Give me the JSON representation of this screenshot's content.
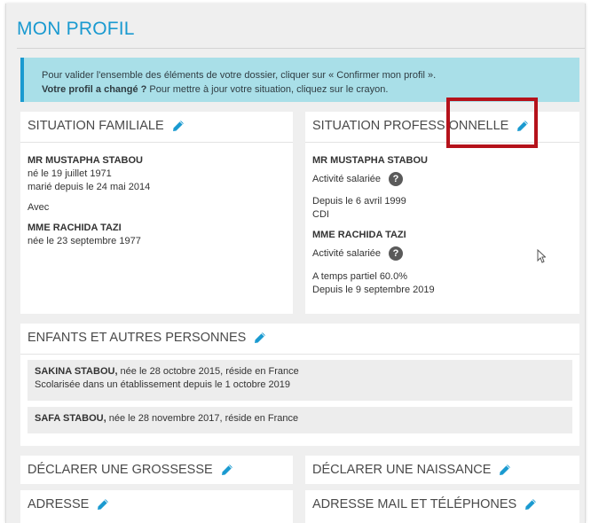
{
  "page": {
    "title": "MON PROFIL"
  },
  "info": {
    "line1": "Pour valider l'ensemble des éléments de votre dossier, cliquer sur « Confirmer mon profil ».",
    "line2_bold": "Votre profil a changé ?",
    "line2_rest": " Pour mettre à jour votre situation, cliquez sur le crayon."
  },
  "situation_familiale": {
    "title": "SITUATION FAMILIALE",
    "person1_name": "MR MUSTAPHA STABOU",
    "person1_birth": "né le 19 juillet 1971",
    "person1_marriage": "marié depuis le 24 mai 2014",
    "with_label": "Avec",
    "person2_name": "MME RACHIDA TAZI",
    "person2_birth": "née le 23 septembre 1977"
  },
  "situation_professionnelle": {
    "title": "SITUATION PROFESSIONNELLE",
    "person1_name": "MR MUSTAPHA STABOU",
    "person1_activity": "Activité salariée",
    "person1_since": "Depuis le 6 avril 1999",
    "person1_contract": "CDI",
    "person2_name": "MME RACHIDA TAZI",
    "person2_activity": "Activité salariée",
    "person2_parttime": "A temps partiel 60.0%",
    "person2_since": "Depuis le 9 septembre 2019",
    "help_glyph": "?"
  },
  "enfants": {
    "title": "ENFANTS ET AUTRES PERSONNES",
    "children": [
      {
        "name": "SAKINA STABOU,",
        "details": " née le 28 octobre 2015, réside en France",
        "extra": "Scolarisée dans un établissement depuis le 1 octobre 2019"
      },
      {
        "name": "SAFA STABOU,",
        "details": " née le 28 novembre 2017, réside en France",
        "extra": ""
      }
    ]
  },
  "grossesse": {
    "title": "DÉCLARER UNE GROSSESSE"
  },
  "naissance": {
    "title": "DÉCLARER UNE NAISSANCE"
  },
  "adresse": {
    "title": "ADRESSE"
  },
  "contact": {
    "title": "ADRESSE MAIL ET TÉLÉPHONES"
  },
  "icons": {
    "edit": "pencil-icon",
    "help": "question-circle-icon",
    "cursor": "mouse-pointer-icon"
  },
  "colors": {
    "brand": "#1a9ad0",
    "info_bg": "#a9dfe8",
    "page_bg": "#efefef",
    "highlight": "#b5121b"
  }
}
